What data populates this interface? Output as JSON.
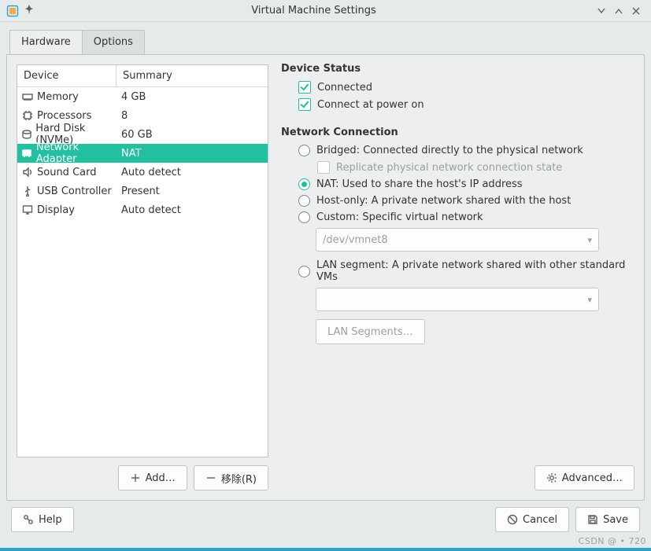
{
  "window": {
    "title": "Virtual Machine Settings"
  },
  "tabs": {
    "hardware": "Hardware",
    "options": "Options"
  },
  "device_table": {
    "head_device": "Device",
    "head_summary": "Summary",
    "rows": [
      {
        "name": "Memory",
        "summary": "4 GB",
        "icon": "memory-icon"
      },
      {
        "name": "Processors",
        "summary": "8",
        "icon": "cpu-icon"
      },
      {
        "name": "Hard Disk (NVMe)",
        "summary": "60 GB",
        "icon": "disk-icon"
      },
      {
        "name": "Network Adapter",
        "summary": "NAT",
        "icon": "nic-icon"
      },
      {
        "name": "Sound Card",
        "summary": "Auto detect",
        "icon": "sound-icon"
      },
      {
        "name": "USB Controller",
        "summary": "Present",
        "icon": "usb-icon"
      },
      {
        "name": "Display",
        "summary": "Auto detect",
        "icon": "display-icon"
      }
    ]
  },
  "left_buttons": {
    "add": "Add…",
    "remove": "移除(R)"
  },
  "right": {
    "status_title": "Device Status",
    "status_connected": "Connected",
    "status_poweron": "Connect at power on",
    "net_title": "Network Connection",
    "bridged": "Bridged: Connected directly to the physical network",
    "replicate": "Replicate physical network connection state",
    "nat": "NAT: Used to share the host's IP address",
    "hostonly": "Host-only: A private network shared with the host",
    "custom": "Custom: Specific virtual network",
    "custom_value": "/dev/vmnet8",
    "lanseg": "LAN segment: A private network shared with other standard VMs",
    "lan_btn": "LAN Segments…",
    "advanced": "Advanced…"
  },
  "dialog_buttons": {
    "help": "Help",
    "cancel": "Cancel",
    "save": "Save"
  },
  "watermark": "CSDN @ • 720"
}
